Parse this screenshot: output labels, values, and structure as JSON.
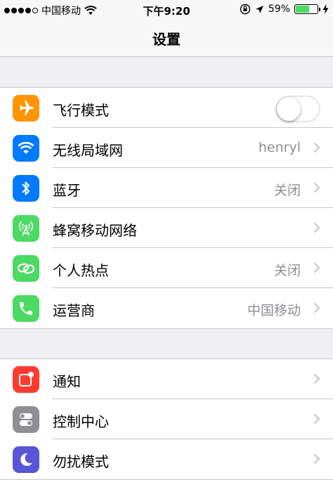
{
  "status_bar": {
    "carrier": "中国移动",
    "time": "下午9:20",
    "battery_percent": "59%",
    "battery_level": 0.59,
    "signal_icon": "signal-dots-icon",
    "wifi_icon": "wifi-icon",
    "lock_icon": "orientation-lock-icon",
    "location_icon": "location-arrow-icon",
    "charging_icon": "charging-bolt-icon"
  },
  "nav": {
    "title": "设置"
  },
  "groups": [
    {
      "rows": [
        {
          "label": "飞行模式",
          "icon": "airplane-icon",
          "color": "#ff9500",
          "toggle": false
        },
        {
          "label": "无线局域网",
          "icon": "wifi-icon",
          "color": "#007aff",
          "value": "henryl"
        },
        {
          "label": "蓝牙",
          "icon": "bluetooth-icon",
          "color": "#007aff",
          "value": "关闭"
        },
        {
          "label": "蜂窝移动网络",
          "icon": "cellular-antenna-icon",
          "color": "#4cd964",
          "value": ""
        },
        {
          "label": "个人热点",
          "icon": "hotspot-link-icon",
          "color": "#4cd964",
          "value": "关闭"
        },
        {
          "label": "运营商",
          "icon": "phone-icon",
          "color": "#4cd964",
          "value": "中国移动"
        }
      ]
    },
    {
      "rows": [
        {
          "label": "通知",
          "icon": "notifications-icon",
          "color": "#ff3b30",
          "value": ""
        },
        {
          "label": "控制中心",
          "icon": "control-center-icon",
          "color": "#8e8e93",
          "value": ""
        },
        {
          "label": "勿扰模式",
          "icon": "moon-icon",
          "color": "#5856d6",
          "value": ""
        }
      ]
    }
  ]
}
